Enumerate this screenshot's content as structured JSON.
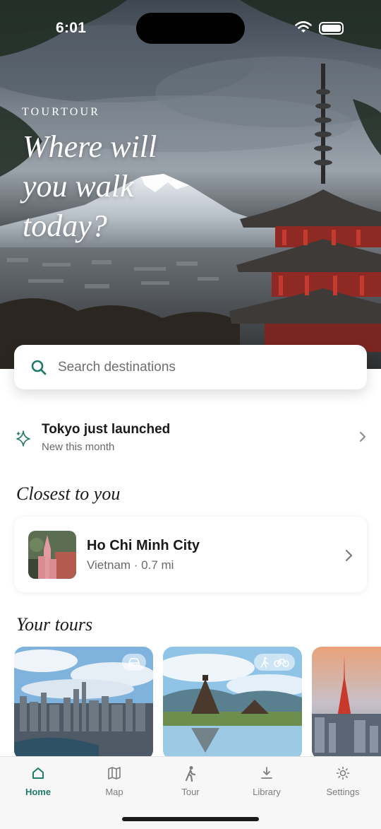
{
  "status_bar": {
    "time": "6:01"
  },
  "hero": {
    "brand": "TOURTOUR",
    "headline": "Where will you walk today?"
  },
  "search": {
    "placeholder": "Search destinations",
    "value": ""
  },
  "launch_banner": {
    "title": "Tokyo just launched",
    "subtitle": "New this month",
    "icon": "sparkle-icon"
  },
  "closest": {
    "heading": "Closest to you",
    "city": "Ho Chi Minh City",
    "meta": "Vietnam · 0.7 mi"
  },
  "tours": {
    "heading": "Your tours",
    "cards": [
      {
        "mode_icons": [
          "car-icon"
        ]
      },
      {
        "mode_icons": [
          "walk-icon",
          "bike-icon"
        ]
      },
      {
        "mode_icons": []
      }
    ]
  },
  "tabbar": {
    "items": [
      {
        "label": "Home",
        "icon": "home-icon",
        "active": true
      },
      {
        "label": "Map",
        "icon": "map-icon",
        "active": false
      },
      {
        "label": "Tour",
        "icon": "walk-icon",
        "active": false
      },
      {
        "label": "Library",
        "icon": "download-icon",
        "active": false
      },
      {
        "label": "Settings",
        "icon": "sun-icon",
        "active": false
      }
    ]
  },
  "colors": {
    "accent": "#1f7a68",
    "text_primary": "#1a1a1a",
    "text_secondary": "#6a6a6a",
    "tabbar_bg": "#f7f7f7"
  }
}
